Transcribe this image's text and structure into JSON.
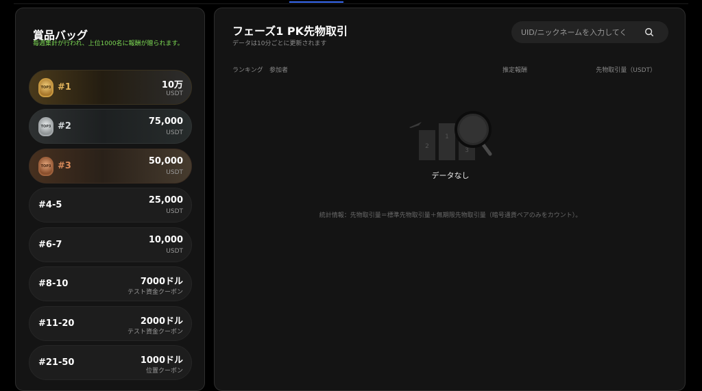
{
  "prizes": {
    "title": "賞品バッグ",
    "subtitle": "毎週集計が行われ、上位1000名に報酬が贈られます。",
    "tiers": [
      {
        "rank": "#1",
        "amount": "10万",
        "unit": "USDT",
        "medal": "TOP3",
        "style": "gold"
      },
      {
        "rank": "#2",
        "amount": "75,000",
        "unit": "USDT",
        "medal": "TOP3",
        "style": "silver"
      },
      {
        "rank": "#3",
        "amount": "50,000",
        "unit": "USDT",
        "medal": "TOP3",
        "style": "bronze"
      },
      {
        "rank": "#4-5",
        "amount": "25,000",
        "unit": "USDT"
      },
      {
        "rank": "#6-7",
        "amount": "10,000",
        "unit": "USDT"
      },
      {
        "rank": "#8-10",
        "amount": "7000ドル",
        "unit": "テスト資金クーポン"
      },
      {
        "rank": "#11-20",
        "amount": "2000ドル",
        "unit": "テスト資金クーポン"
      },
      {
        "rank": "#21-50",
        "amount": "1000ドル",
        "unit": "位置クーポン"
      }
    ]
  },
  "main": {
    "title": "フェーズ1 PK先物取引",
    "subtitle": "データは10分ごとに更新されます",
    "search": {
      "placeholder": "UID/ニックネームを入力してく",
      "icon": "search-icon"
    },
    "columns": {
      "rank": "ランキング",
      "participant": "参加者",
      "estimated_reward": "推定報酬",
      "volume": "先物取引量（USDT）"
    },
    "empty_text": "データなし",
    "footnote": "統計情報：先物取引量＝標準先物取引量＋無期限先物取引量（暗号通貨ペアのみをカウント）。"
  },
  "colors": {
    "accent_tab": "#3b6cf5",
    "subtitle_green": "#7ddb54",
    "gold": "#e3b45c",
    "silver": "#d5d9db",
    "bronze": "#d88a5a"
  }
}
